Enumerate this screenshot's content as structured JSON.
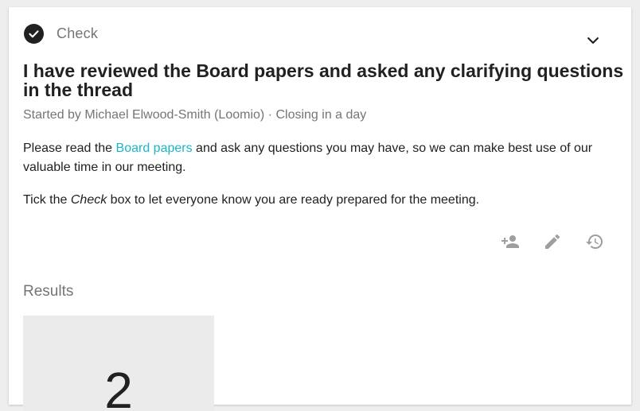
{
  "poll": {
    "type_label": "Check",
    "title": "I have reviewed the Board papers and asked any clarifying questions in the thread",
    "meta": "Started by Michael Elwood-Smith (Loomio) · Closing in a day",
    "details": {
      "p1_before": "Please read the ",
      "p1_link": "Board papers",
      "p1_after": " and ask any questions you may have, so we can make best use of our valuable time in our meeting.",
      "p2_before": "Tick the ",
      "p2_em": "Check",
      "p2_after": " box to let everyone know you are ready prepared for the meeting."
    }
  },
  "actions": {
    "icons": [
      "add-person-icon",
      "edit-icon",
      "history-icon"
    ]
  },
  "results": {
    "heading": "Results",
    "count": "2"
  },
  "colors": {
    "link": "#1ab6c8",
    "icon_gray": "#9e9e9e",
    "text_primary": "#212121",
    "text_secondary": "#757575",
    "result_bg": "#ebebeb"
  }
}
